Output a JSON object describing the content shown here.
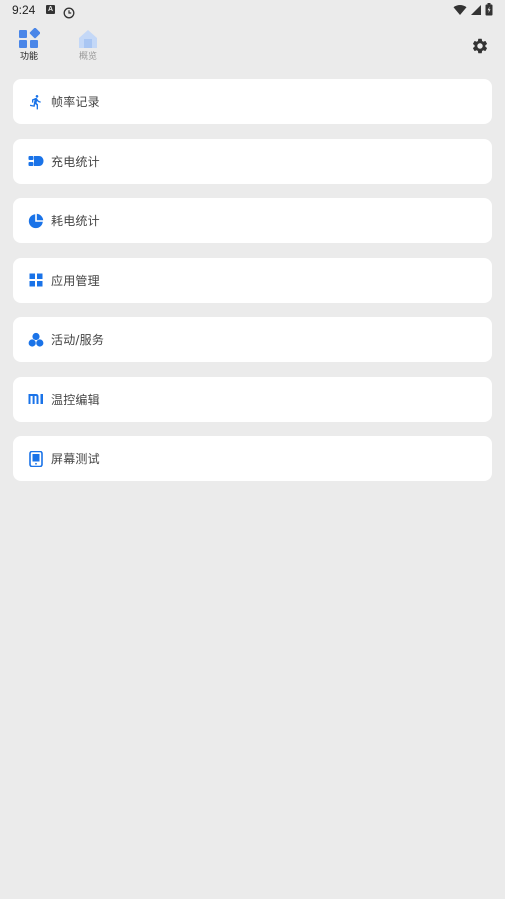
{
  "status_bar": {
    "time": "9:24",
    "a_icon_letter": "A",
    "icons": [
      "notification-a-icon",
      "clock-icon",
      "wifi-icon",
      "cellular-signal-icon",
      "battery-icon"
    ]
  },
  "tabs": [
    {
      "label": "功能",
      "icon": "dashboard-icon",
      "active": true
    },
    {
      "label": "概览",
      "icon": "home-icon",
      "active": false
    }
  ],
  "settings": {
    "icon": "gear-icon"
  },
  "colors": {
    "accent": "#1a73e8",
    "background": "#ebebeb",
    "card": "#ffffff",
    "tab_active_icon": "#4a86e8",
    "tab_inactive_icon": "#b3cdf5"
  },
  "features": [
    {
      "label": "帧率记录",
      "icon": "running-icon"
    },
    {
      "label": "充电统计",
      "icon": "charging-icon"
    },
    {
      "label": "耗电统计",
      "icon": "pie-chart-icon"
    },
    {
      "label": "应用管理",
      "icon": "apps-grid-icon"
    },
    {
      "label": "活动/服务",
      "icon": "activity-bubbles-icon"
    },
    {
      "label": "温控编辑",
      "icon": "mi-logo-icon"
    },
    {
      "label": "屏幕测试",
      "icon": "phone-screen-icon"
    }
  ]
}
